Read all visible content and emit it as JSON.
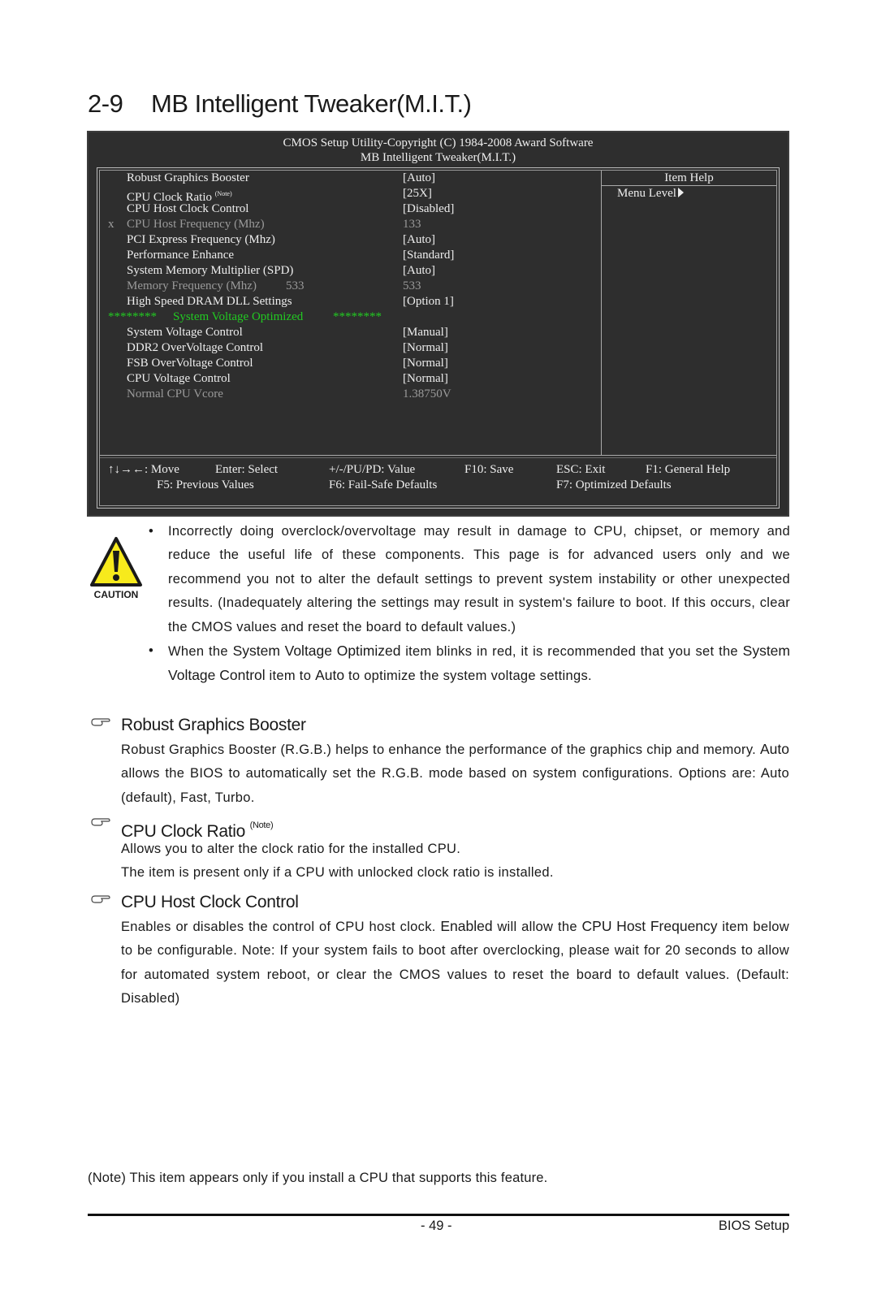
{
  "title": {
    "number": "2-9",
    "text": "MB Intelligent Tweaker(M.I.T.)"
  },
  "bios": {
    "header_line1": "CMOS Setup Utility-Copyright (C) 1984-2008 Award Software",
    "header_line2": "MB Intelligent Tweaker(M.I.T.)",
    "items": [
      {
        "mark": "",
        "label": "Robust Graphics Booster",
        "note": "",
        "value": "[Auto]",
        "dimmed": false
      },
      {
        "mark": "",
        "label": "CPU Clock Ratio",
        "note": "(Note)",
        "value": "[25X]",
        "dimmed": false
      },
      {
        "mark": "",
        "label": "CPU Host Clock Control",
        "note": "",
        "value": "[Disabled]",
        "dimmed": false
      },
      {
        "mark": "x",
        "label": "CPU Host Frequency (Mhz)",
        "note": "",
        "value": "133",
        "dimmed": true
      },
      {
        "mark": "",
        "label": "PCI Express Frequency (Mhz)",
        "note": "",
        "value": "[Auto]",
        "dimmed": false
      },
      {
        "mark": "",
        "label": "Performance Enhance",
        "note": "",
        "value": "[Standard]",
        "dimmed": false
      },
      {
        "mark": "",
        "label": "System Memory Multiplier (SPD)",
        "note": "",
        "value": "[Auto]",
        "dimmed": false
      },
      {
        "mark": "",
        "label": "Memory Frequency (Mhz)",
        "extra": "533",
        "note": "",
        "value": "533",
        "dimmed": true
      },
      {
        "mark": "",
        "label": "High Speed DRAM DLL Settings",
        "note": "",
        "value": "[Option 1]",
        "dimmed": false
      }
    ],
    "separator": {
      "stars_left": "********",
      "text": "System Voltage Optimized",
      "stars_right": "********",
      "color": "#22c922"
    },
    "voltage_items": [
      {
        "label": "System Voltage Control",
        "value": "[Manual]",
        "dimmed": false
      },
      {
        "label": "DDR2 OverVoltage Control",
        "value": "[Normal]",
        "dimmed": false
      },
      {
        "label": "FSB OverVoltage Control",
        "value": "[Normal]",
        "dimmed": false
      },
      {
        "label": "CPU Voltage Control",
        "value": "[Normal]",
        "dimmed": false
      },
      {
        "label": "Normal CPU Vcore",
        "value": "1.38750V",
        "dimmed": true
      }
    ],
    "help": {
      "title": "Item Help",
      "menu_level": "Menu Level"
    },
    "keys": {
      "move": "↑↓→←: Move",
      "enter": "Enter: Select",
      "value": "+/-/PU/PD: Value",
      "save": "F10: Save",
      "exit": "ESC: Exit",
      "help": "F1: General Help",
      "previous": "F5: Previous Values",
      "failsafe": "F6: Fail-Safe Defaults",
      "optimized": "F7: Optimized Defaults"
    }
  },
  "caution": {
    "label": "CAUTION",
    "bullet1": "Incorrectly doing overclock/overvoltage may result in damage to CPU, chipset, or memory and reduce the useful life of these components.  This page is for advanced users only and we recommend you not to alter the default settings to prevent system instability or other unexpected results. (Inadequately altering the settings may result in system's failure to boot. If this occurs, clear the CMOS values and reset the board to default values.)",
    "bullet2_a": "When the ",
    "bullet2_em1": "System Voltage Optimized",
    "bullet2_b": " item blinks in red, it is recommended that you set the ",
    "bullet2_em2": "System Voltage Control",
    "bullet2_c": " item to ",
    "bullet2_em3": "Auto",
    "bullet2_d": " to optimize the system voltage settings."
  },
  "sections": [
    {
      "heading": "Robust Graphics Booster",
      "p1": "Robust Graphics Booster (R.G.B.) helps to enhance the performance of the graphics chip and memory. ",
      "p1_em": "Auto",
      "p1_b": " allows the BIOS to automatically set the R.G.B. mode based on system",
      "p1_c": "configurations. Options are: Auto (default), Fast, Turbo."
    },
    {
      "heading": "CPU Clock Ratio",
      "note": "(Note)",
      "p1": "Allows you to alter the clock ratio for the installed CPU.",
      "p2": "The item is present only if a CPU with unlocked clock ratio is installed."
    },
    {
      "heading": "CPU Host Clock Control",
      "p1_a": "Enables or disables the control of CPU host clock. ",
      "p1_em1": "Enabled",
      "p1_b": " will allow the ",
      "p1_em2": "CPU Host Frequency",
      "p1_c": " item below to be configurable. Note: If your system fails to boot after overclocking, please wait for 20 seconds to allow for automated system reboot, or clear the CMOS values to reset the board to default values. (Default: Disabled)"
    }
  ],
  "footnote": "(Note) This item appears only if you install a CPU that supports this feature.",
  "footer": {
    "page_number": "- 49 -",
    "label": "BIOS Setup"
  }
}
